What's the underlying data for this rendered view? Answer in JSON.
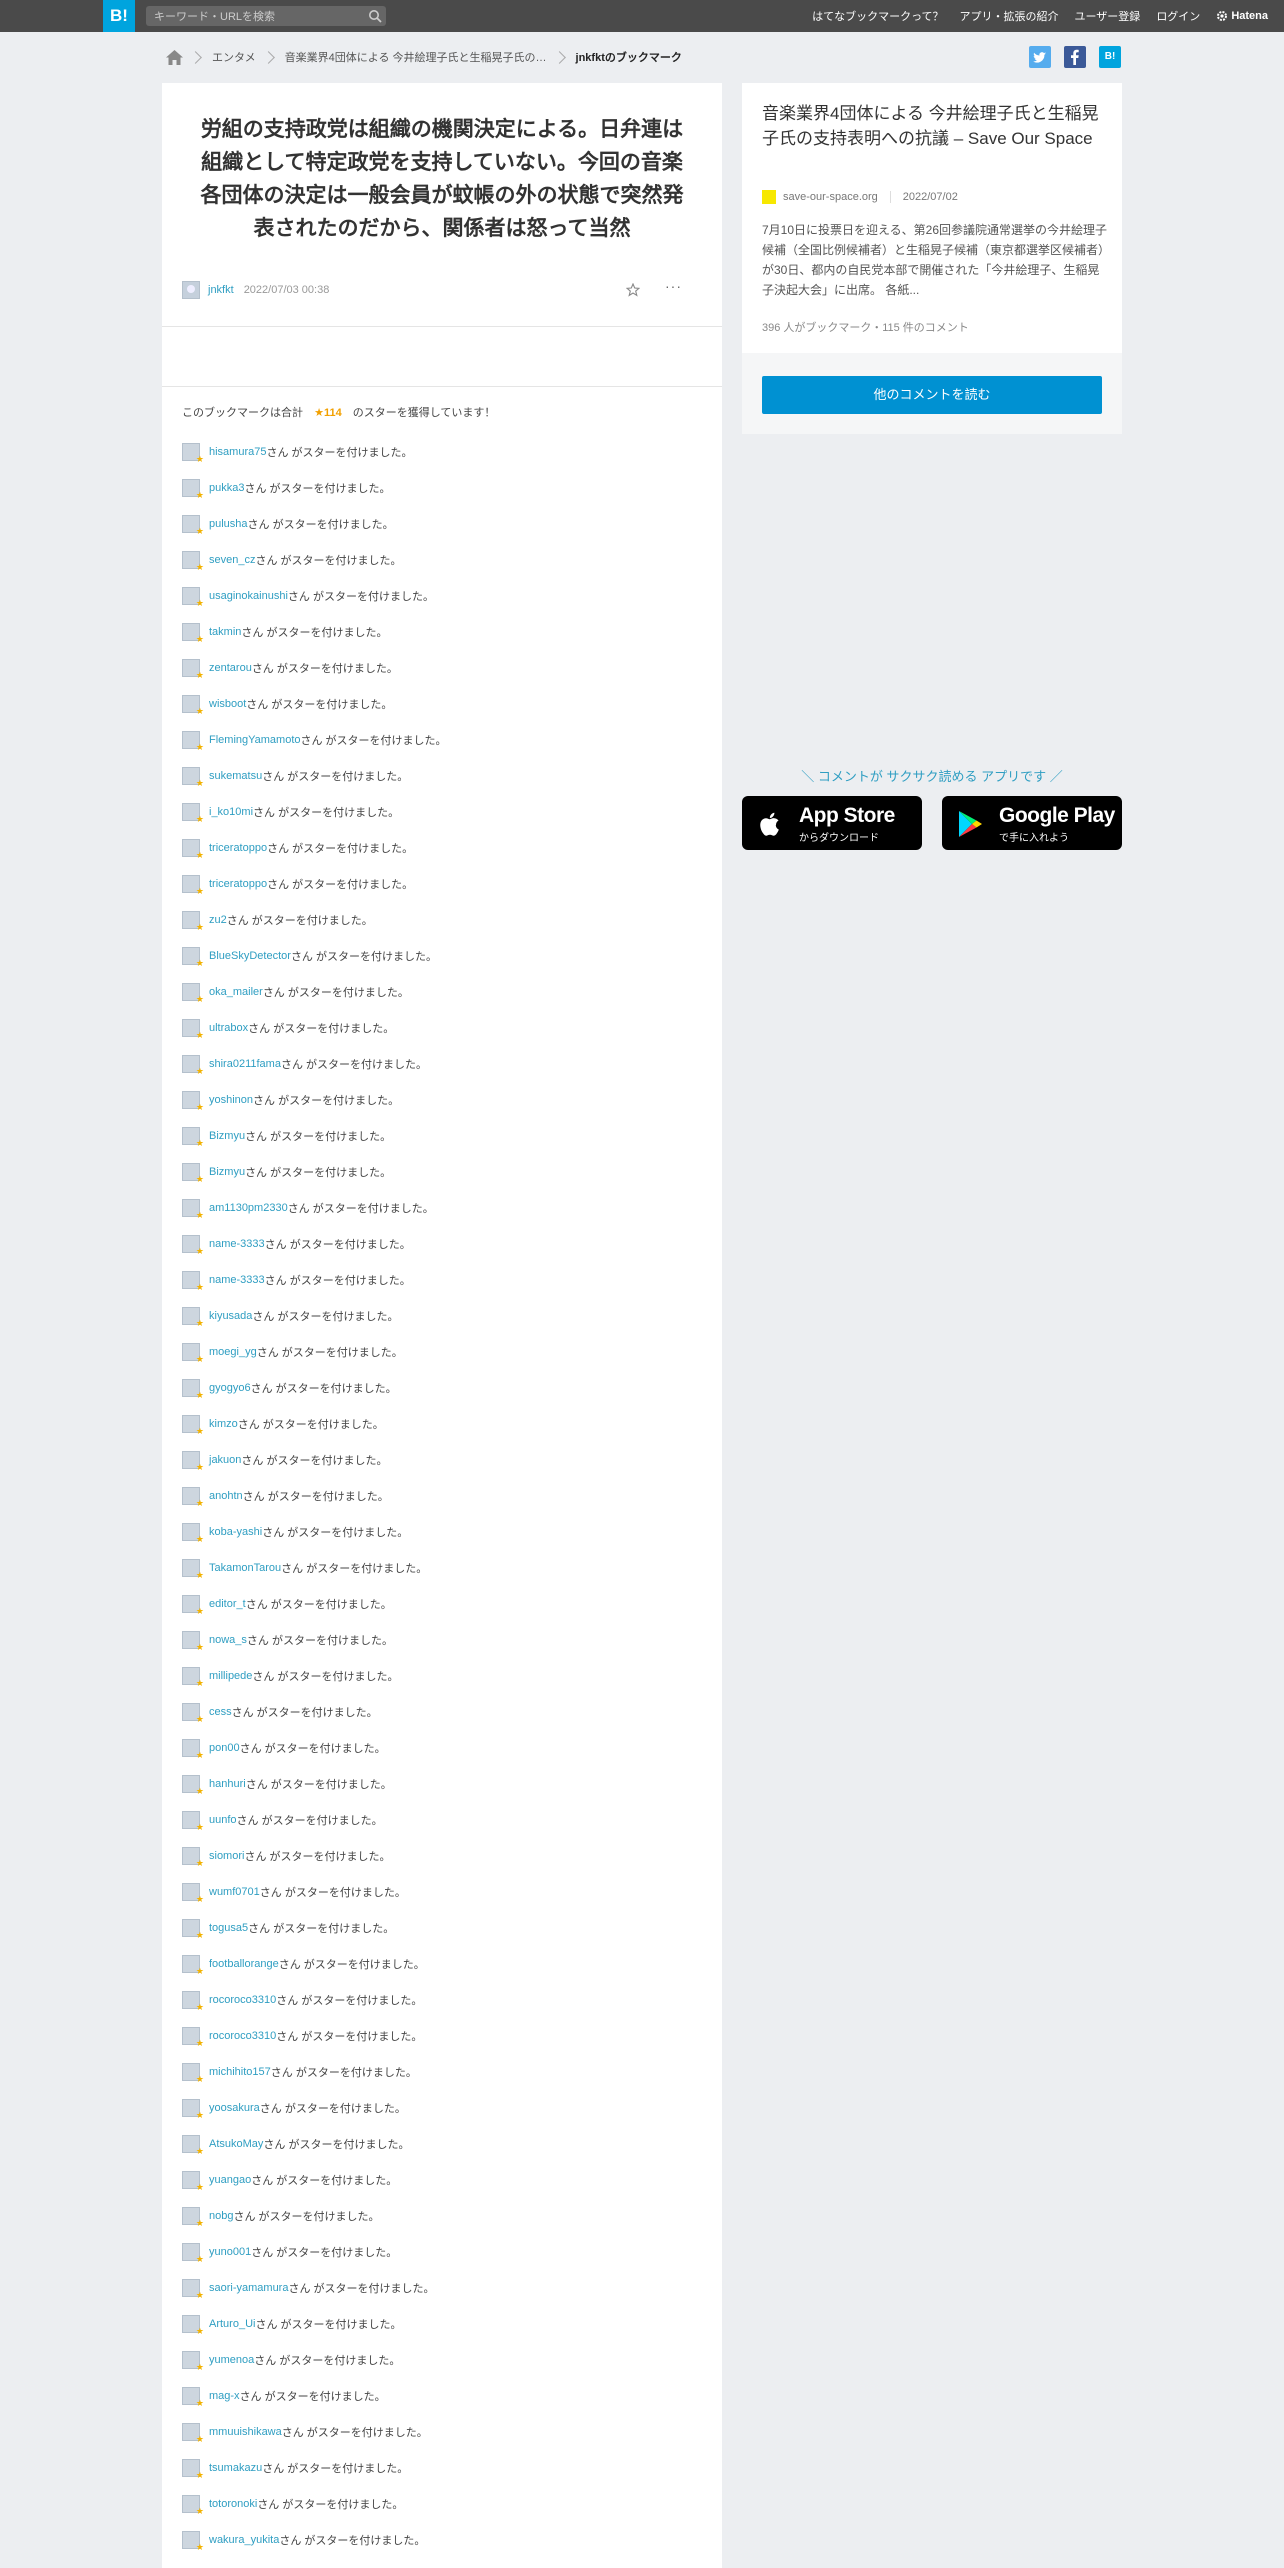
{
  "topbar": {
    "logo": "B!",
    "search_placeholder": "キーワード・URLを検索",
    "nav": [
      "はてなブックマークって？",
      "アプリ・拡張の紹介",
      "ユーザー登録",
      "ログイン"
    ],
    "brand": "Hatena"
  },
  "breadcrumb": {
    "items": [
      "エンタメ",
      "音楽業界4団体による 今井絵理子氏と生稲晃子氏の…"
    ],
    "current": "jnkfktのブックマーク"
  },
  "share": {
    "hatena": "B!"
  },
  "bookmark": {
    "comment": "労組の支持政党は組織の機関決定による。日弁連は組織として特定政党を支持していない。今回の音楽各団体の決定は一般会員が蚊帳の外の状態で突然発表されたのだから、関係者は怒って当然",
    "user": "jnkfkt",
    "datetime": "2022/07/03 00:38",
    "more": "···"
  },
  "stars": {
    "summary_prefix": "このブックマークは合計",
    "star_symbol": "★",
    "total": "114",
    "summary_suffix": "のスターを獲得しています！",
    "suffix": "さん がスターを付けました。",
    "users": [
      "hisamura75",
      "pukka3",
      "pulusha",
      "seven_cz",
      "usaginokainushi",
      "takmin",
      "zentarou",
      "wisboot",
      "FlemingYamamoto",
      "sukematsu",
      "i_ko10mi",
      "triceratoppo",
      "triceratoppo",
      "zu2",
      "BlueSkyDetector",
      "oka_mailer",
      "ultrabox",
      "shira0211fama",
      "yoshinon",
      "Bizmyu",
      "Bizmyu",
      "am1130pm2330",
      "name-3333",
      "name-3333",
      "kiyusada",
      "moegi_yg",
      "gyogyo6",
      "kimzo",
      "jakuon",
      "anohtn",
      "koba-yashi",
      "TakamonTarou",
      "editor_t",
      "nowa_s",
      "millipede",
      "cess",
      "pon00",
      "hanhuri",
      "uunfo",
      "siomori",
      "wumf0701",
      "togusa5",
      "footballorange",
      "rocoroco3310",
      "rocoroco3310",
      "michihito157",
      "yoosakura",
      "AtsukoMay",
      "yuangao",
      "nobg",
      "yuno001",
      "saori-yamamura",
      "Arturo_Ui",
      "yumenoa",
      "mag-x",
      "mmuuishikawa",
      "tsumakazu",
      "totoronoki",
      "wakura_yukita"
    ]
  },
  "entry": {
    "title": "音楽業界4団体による 今井絵理子氏と生稲晃子氏の支持表明への抗議 – Save Our Space",
    "domain": "save-our-space.org",
    "date": "2022/07/02",
    "description": "7月10日に投票日を迎える、第26回参議院通常選挙の今井絵理子候補（全国比例候補者）と生稲晃子候補（東京都選挙区候補者）が30日、都内の自民党本部で開催された「今井絵理子、生稲晃子決起大会」に出席。 各紙...",
    "counts": "396 人がブックマーク・115 件のコメント",
    "read_more": "他のコメントを読む"
  },
  "app_promo": {
    "text": "＼ コメントが サクサク読める アプリです ／",
    "appstore_name": "App Store",
    "appstore_sub": "からダウンロード",
    "googleplay_name": "Google Play",
    "googleplay_sub": "で手に入れよう"
  },
  "colors": {
    "accent": "#00a4de",
    "link": "#2f9ec2",
    "star": "#f2a000",
    "topbar": "#4a4a4a"
  }
}
